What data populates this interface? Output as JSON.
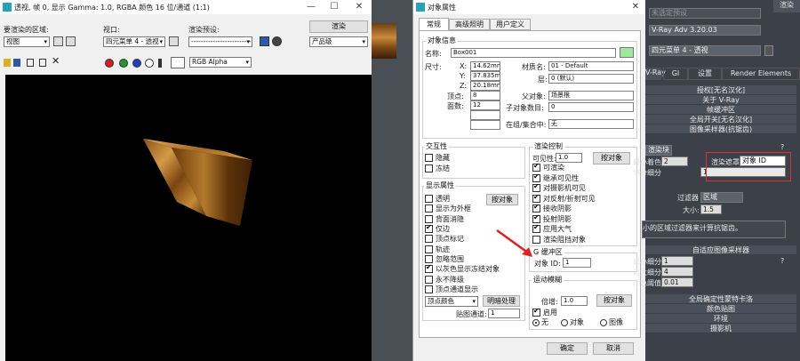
{
  "render_window": {
    "title": "透视, 帧 0, 显示 Gamma: 1.0, RGBA 颜色 16 位/通道 (1:1)",
    "area_label": "要渲染的区域:",
    "area_value": "视图",
    "viewport_label": "视口:",
    "viewport_value": "四元菜单 4 - 透视",
    "preset_label": "渲染预设:",
    "preset_value": "-------------------------",
    "render_button": "渲染",
    "quality_value": "产品级",
    "channel_value": "RGB Alpha",
    "close_glyph": "✕",
    "minimize_glyph": "—",
    "maximize_glyph": "☐"
  },
  "dialog": {
    "title": "对象属性",
    "tabs": [
      "常规",
      "高级照明",
      "用户定义"
    ],
    "object_info_title": "对象信息",
    "name_label": "名称:",
    "name_value": "Box001",
    "name_color": "#9ee89c",
    "dimensions_label": "尺寸:",
    "x_label": "X:",
    "x_value": "14.62mm",
    "y_label": "Y:",
    "y_value": "37.835mm",
    "z_label": "Z:",
    "z_value": "20.18mm",
    "material_name_label": "材质名:",
    "material_name_value": "01 - Default",
    "layer_label": "层:",
    "layer_value": "0 (默认)",
    "vertices_label": "顶点:",
    "vertices_value": "8",
    "faces_label": "面数:",
    "faces_value": "12",
    "parent_label": "父对象:",
    "parent_value": "场景根",
    "children_label": "子对象数目:",
    "children_value": "0",
    "group_label": "在组/集合中:",
    "group_value": "无",
    "interactivity_title": "交互性",
    "hide_label": "隐藏",
    "freeze_label": "冻结",
    "display_props_title": "显示属性",
    "by_object_button": "按对象",
    "display_items": [
      {
        "label": "透明",
        "checked": false
      },
      {
        "label": "显示为外框",
        "checked": false
      },
      {
        "label": "背面消隐",
        "checked": false
      },
      {
        "label": "仅边",
        "checked": true
      },
      {
        "label": "顶点标记",
        "checked": false
      },
      {
        "label": "轨迹",
        "checked": false
      },
      {
        "label": "忽略范围",
        "checked": false
      },
      {
        "label": "以灰色显示冻结对象",
        "checked": true
      },
      {
        "label": "永不降级",
        "checked": false
      },
      {
        "label": "顶点通道显示",
        "checked": false
      }
    ],
    "vertex_color_value": "顶点颜色",
    "shading_button": "明暗处理",
    "map_channel_label": "贴图通道:",
    "map_channel_value": "1",
    "render_control_title": "渲染控制",
    "visibility_label": "可见性:",
    "visibility_value": "1.0",
    "render_by_object_button": "按对象",
    "render_items": [
      {
        "label": "可渲染",
        "checked": true
      },
      {
        "label": "继承可见性",
        "checked": true
      },
      {
        "label": "对摄影机可见",
        "checked": true
      },
      {
        "label": "对反射/折射可见",
        "checked": true
      },
      {
        "label": "接收阴影",
        "checked": true
      },
      {
        "label": "投射阴影",
        "checked": true
      },
      {
        "label": "应用大气",
        "checked": true
      },
      {
        "label": "渲染阻挡对象",
        "checked": false
      }
    ],
    "gbuffer_title": "G 缓冲区",
    "object_id_label": "对象 ID:",
    "object_id_value": "1",
    "motion_blur_title": "运动模糊",
    "multiplier_label": "倍增:",
    "multiplier_value": "1.0",
    "motion_by_object_button": "按对象",
    "enable_label": "启用",
    "radio_none": "无",
    "radio_object": "对象",
    "radio_image": "图像",
    "ok_button": "确定",
    "cancel_button": "取消",
    "close_glyph": "✕"
  },
  "right_panel": {
    "preset_value": "未选定预设",
    "renderer_value": "V-Ray Adv 3.20.03",
    "view_value": "四元菜单 4 - 透视",
    "render_button": "渲染",
    "tabs": [
      "V-Ray",
      "GI",
      "设置",
      "Render Elements"
    ],
    "rollouts_top": [
      "授权[无名汉化]",
      "关于 V-Ray",
      "帧缓冲区",
      "全局开关[无名汉化]",
      "图像采样器(抗锯齿)"
    ],
    "sampler_type": "渲染块",
    "min_shading_label": "最小着色速率",
    "min_shading_value": "2",
    "render_mask_label": "渲染遮罩",
    "render_mask_value": "对象 ID",
    "subdivs_label": "划分细分",
    "subdivs_value": "1",
    "filter_title": "过滤器",
    "filter_type": "区域",
    "size_label": "大小:",
    "size_value": "1.5",
    "filter_desc": "使用可变大小的区域过滤器来计算抗锯齿。",
    "adaptive_title": "自适应图像采样器",
    "adaptive_rows": [
      {
        "label": "最小细分",
        "value": "1"
      },
      {
        "label": "最大细分",
        "value": "4"
      },
      {
        "label": "颜色阈值",
        "value": "0.01"
      }
    ],
    "rollouts_bottom": [
      "全局确定性蒙特卡洛",
      "颜色贴图",
      "环境",
      "摄影机"
    ],
    "help_glyph": "?"
  }
}
